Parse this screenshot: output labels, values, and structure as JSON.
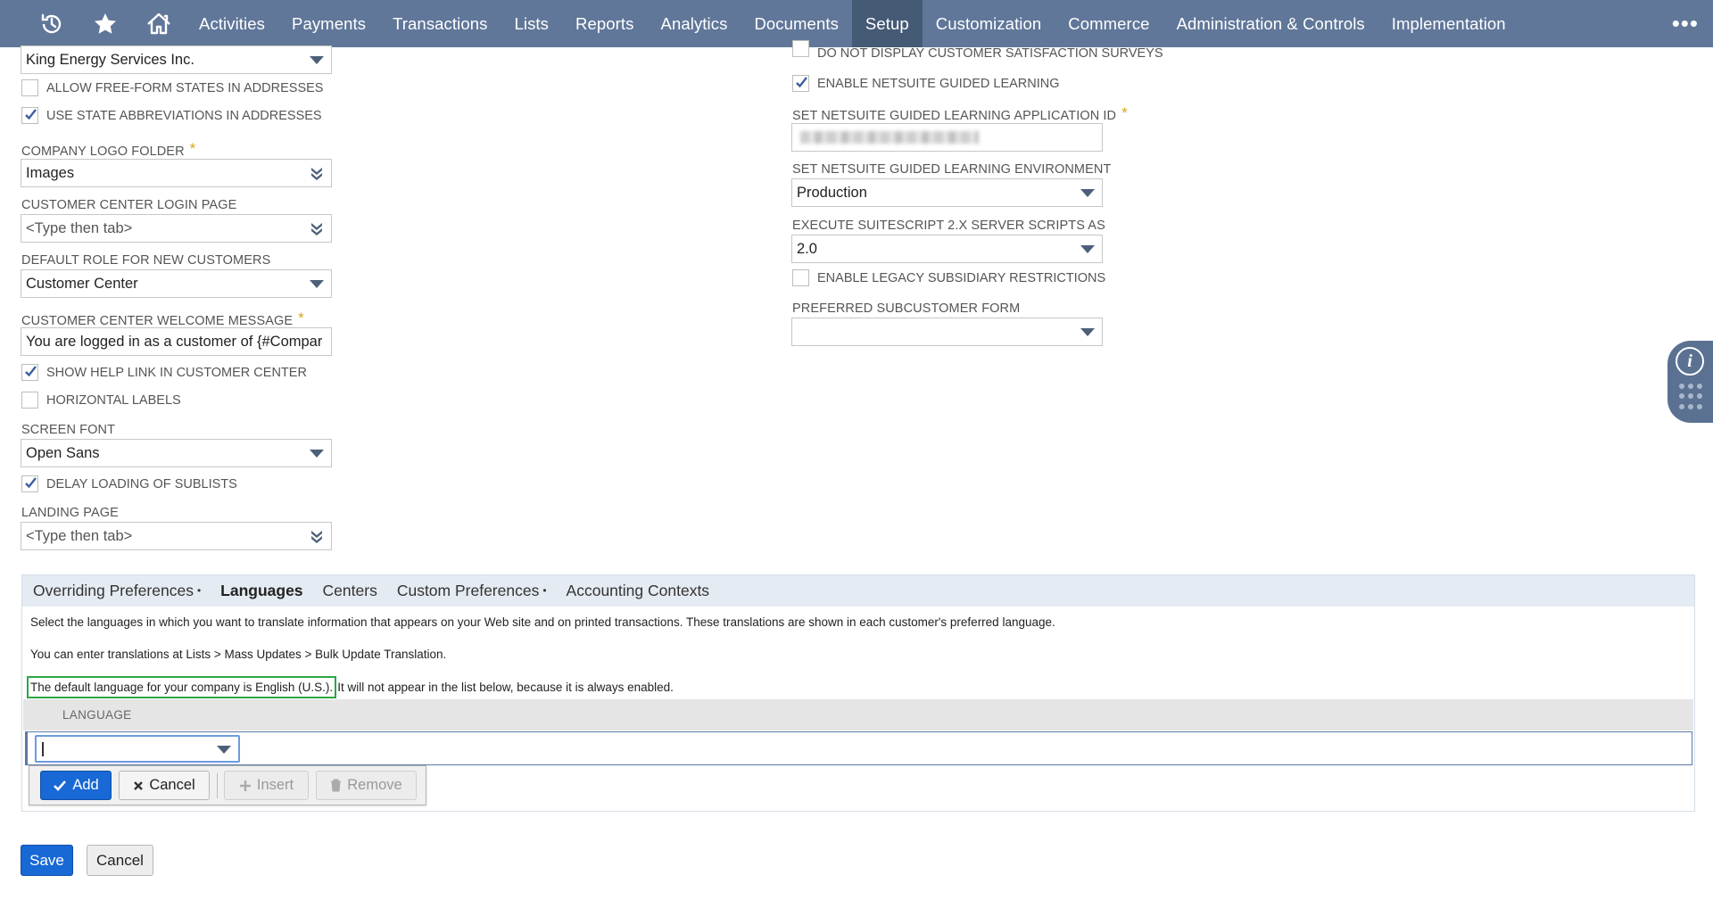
{
  "nav": {
    "items": [
      "Activities",
      "Payments",
      "Transactions",
      "Lists",
      "Reports",
      "Analytics",
      "Documents",
      "Setup",
      "Customization",
      "Commerce",
      "Administration & Controls",
      "Implementation"
    ],
    "active": "Setup",
    "more": "•••",
    "icons": [
      "recent-records-icon",
      "star-icon",
      "home-icon"
    ]
  },
  "left": {
    "company": {
      "value": "King Energy Services Inc."
    },
    "allow_free_form_states": {
      "label": "ALLOW FREE-FORM STATES IN ADDRESSES",
      "checked": false
    },
    "use_state_abbreviations": {
      "label": "USE STATE ABBREVIATIONS IN ADDRESSES",
      "checked": true
    },
    "company_logo_folder": {
      "label": "COMPANY LOGO FOLDER",
      "required": "*",
      "value": "Images"
    },
    "customer_center_login_page": {
      "label": "CUSTOMER CENTER LOGIN PAGE",
      "placeholder": "<Type then tab>"
    },
    "default_role": {
      "label": "DEFAULT ROLE FOR NEW CUSTOMERS",
      "value": "Customer Center"
    },
    "welcome_message": {
      "label": "CUSTOMER CENTER WELCOME MESSAGE",
      "required": "*",
      "value": "You are logged in as a customer of {#Compar"
    },
    "show_help_link": {
      "label": "SHOW HELP LINK IN CUSTOMER CENTER",
      "checked": true
    },
    "horizontal_labels": {
      "label": "HORIZONTAL LABELS",
      "checked": false
    },
    "screen_font": {
      "label": "SCREEN FONT",
      "value": "Open Sans"
    },
    "delay_loading": {
      "label": "DELAY LOADING OF SUBLISTS",
      "checked": true
    },
    "landing_page": {
      "label": "LANDING PAGE",
      "placeholder": "<Type then tab>"
    }
  },
  "right": {
    "no_surveys": {
      "label": "DO NOT DISPLAY CUSTOMER SATISFACTION SURVEYS",
      "checked": false
    },
    "guided_learning": {
      "label": "ENABLE NETSUITE GUIDED LEARNING",
      "checked": true
    },
    "gl_app_id": {
      "label": "SET NETSUITE GUIDED LEARNING APPLICATION ID",
      "required": "*"
    },
    "gl_environment": {
      "label": "SET NETSUITE GUIDED LEARNING ENVIRONMENT",
      "value": "Production"
    },
    "suitescript": {
      "label": "EXECUTE SUITESCRIPT 2.X SERVER SCRIPTS AS",
      "value": "2.0"
    },
    "legacy_subsidiary": {
      "label": "ENABLE LEGACY SUBSIDIARY RESTRICTIONS",
      "checked": false
    },
    "subcustomer_form": {
      "label": "PREFERRED SUBCUSTOMER FORM",
      "value": ""
    }
  },
  "subtabs": {
    "tabs": [
      {
        "label": "Overriding Preferences",
        "dot": "•"
      },
      {
        "label": "Languages",
        "dot": ""
      },
      {
        "label": "Centers",
        "dot": ""
      },
      {
        "label": "Custom Preferences",
        "dot": "•"
      },
      {
        "label": "Accounting Contexts",
        "dot": ""
      }
    ],
    "active": "Languages"
  },
  "languages": {
    "line1": "Select the languages in which you want to translate information that appears on your Web site and on printed transactions. These translations are shown in each customer's preferred language.",
    "line2": "You can enter translations at Lists > Mass Updates > Bulk Update Translation.",
    "line3_highlight": "The default language for your company is English (U.S.).",
    "line3_rest": "It will not appear in the list below, because it is always enabled.",
    "column_header": "LANGUAGE",
    "buttons": {
      "add": "Add",
      "cancel": "Cancel",
      "insert": "Insert",
      "remove": "Remove"
    }
  },
  "footer": {
    "save": "Save",
    "cancel": "Cancel"
  },
  "colors": {
    "nav_bg": "#607799",
    "nav_active": "#455a75",
    "primary_button": "#1868d6",
    "required": "#d4a51b",
    "highlight_border": "#2ca644"
  }
}
